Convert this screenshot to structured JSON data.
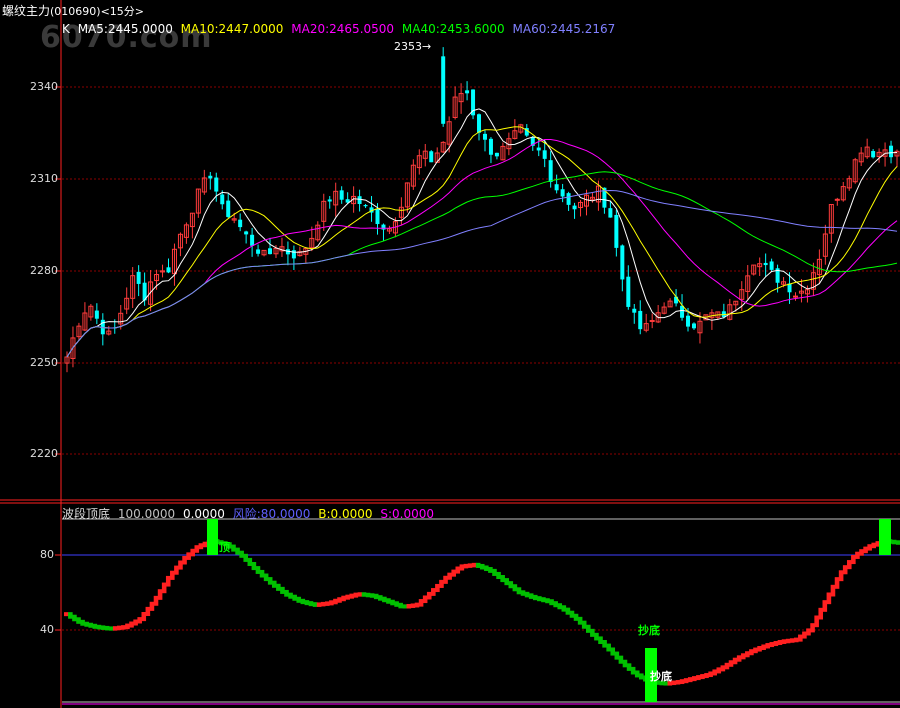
{
  "title": "螺纹主力",
  "code": "(010690)",
  "period": "<15分>",
  "watermark": "6070.com",
  "ma": {
    "k_label": "K",
    "items": [
      {
        "text": "MA5:2445.0000",
        "color": "#ffffff"
      },
      {
        "text": "MA10:2447.0000",
        "color": "#ffff00"
      },
      {
        "text": "MA20:2465.0500",
        "color": "#ff00ff"
      },
      {
        "text": "MA40:2453.6000",
        "color": "#00ff00"
      },
      {
        "text": "MA60:2445.2167",
        "color": "#8080ff"
      }
    ]
  },
  "price_axis": {
    "ticks": [
      "2340",
      "2310",
      "2280",
      "2250",
      "2220"
    ]
  },
  "high_marker": "2353",
  "indicator": {
    "name": "波段顶底",
    "values": [
      {
        "text": "100.0000",
        "color": "#c0c0c0"
      },
      {
        "text": "0.0000",
        "color": "#ffffff"
      },
      {
        "text": "风险:80.0000",
        "color": "#6060ff"
      },
      {
        "text": "B:0.0000",
        "color": "#ffff00"
      },
      {
        "text": "S:0.0000",
        "color": "#ff00ff"
      }
    ],
    "axis_ticks": [
      "80",
      "40"
    ],
    "signals": {
      "top": "顶",
      "bottom": "抄底",
      "bottom_mark": "抄底"
    }
  },
  "colors": {
    "up": "#ff3c3c",
    "down": "#00ffff",
    "grid": "#8b0000",
    "frame": "#ff2020"
  }
}
